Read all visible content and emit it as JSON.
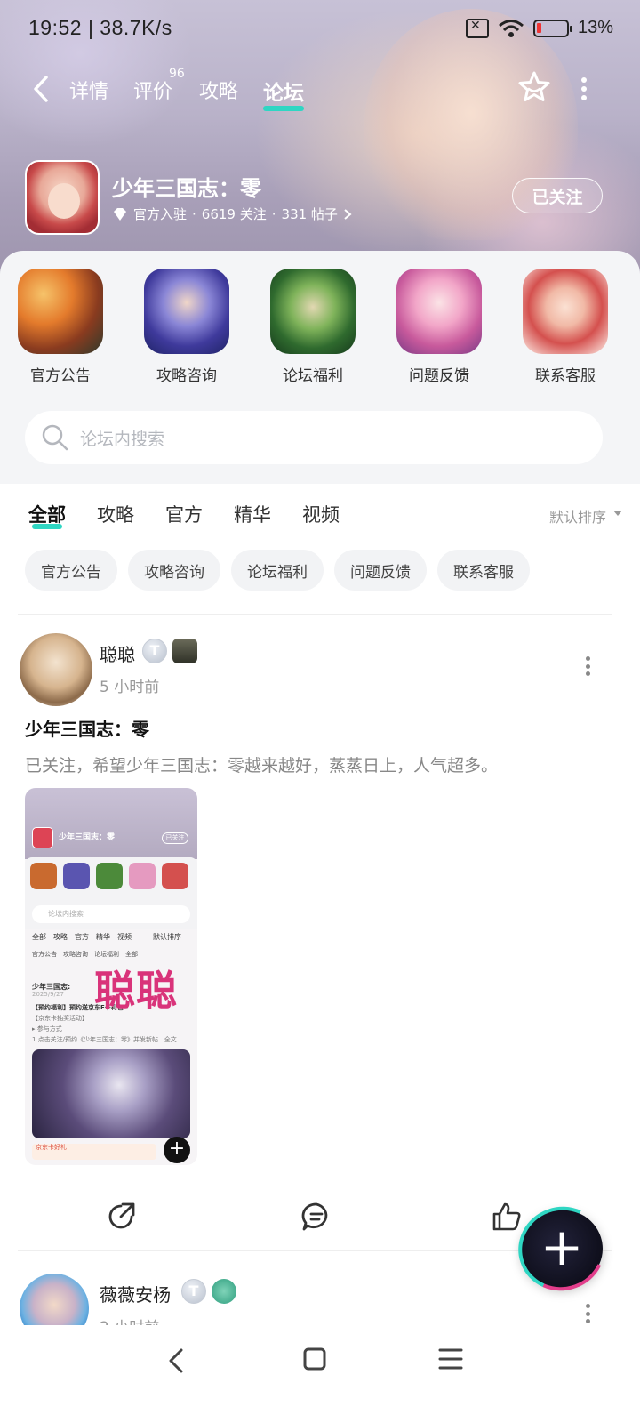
{
  "status": {
    "time_speed": "19:52 | 38.7K/s",
    "battery": "13%"
  },
  "nav": {
    "tabs": [
      {
        "label": "详情"
      },
      {
        "label": "评价",
        "badge": "96"
      },
      {
        "label": "攻略"
      },
      {
        "label": "论坛",
        "active": true
      }
    ]
  },
  "game": {
    "title": "少年三国志：零",
    "meta_official": "官方入驻",
    "meta_follows": "6619 关注",
    "meta_posts": "331 帖子",
    "meta_sep": "·",
    "follow_label": "已关注"
  },
  "categories": [
    {
      "label": "官方公告",
      "icon": "official-notice-thumb"
    },
    {
      "label": "攻略咨询",
      "icon": "guide-consult-thumb"
    },
    {
      "label": "论坛福利",
      "icon": "forum-benefit-thumb"
    },
    {
      "label": "问题反馈",
      "icon": "feedback-thumb"
    },
    {
      "label": "联系客服",
      "icon": "customer-service-thumb"
    }
  ],
  "search": {
    "placeholder": "论坛内搜索"
  },
  "filter_tabs": [
    "全部",
    "攻略",
    "官方",
    "精华",
    "视频"
  ],
  "sort_label": "默认排序",
  "chips": [
    "官方公告",
    "攻略咨询",
    "论坛福利",
    "问题反馈",
    "联系客服"
  ],
  "post": {
    "username": "聪聪",
    "level_letter": "T",
    "time": "5 小时前",
    "title": "少年三国志：零",
    "body": "已关注，希望少年三国志：零越来越好，蒸蒸日上，人气超多。",
    "image": {
      "mini_title": "少年三国志：零",
      "mini_follow": "已关注",
      "mini_search": "论坛内搜索",
      "mini_tabs": "全部　攻略　官方　精华　视频　　　默认排序",
      "mini_chips": "官方公告　攻略咨询　论坛福利　全部",
      "mini_post_title": "少年三国志:",
      "mini_post_date": "2025/9/27",
      "mini_line1": "【预约福利】预约送京东E卡礼包~",
      "mini_line2": "【京东卡抽奖活动】",
      "mini_line3": "▸ 参与方式",
      "mini_line4": "1.点击关注/预约《少年三国志：零》并发新帖...全文",
      "mini_ad": "京东卡好礼",
      "watermark": "聪聪"
    }
  },
  "post2": {
    "username": "薇薇安杨",
    "level_letter": "T",
    "time": "2 小时前"
  },
  "fab_label": "+"
}
